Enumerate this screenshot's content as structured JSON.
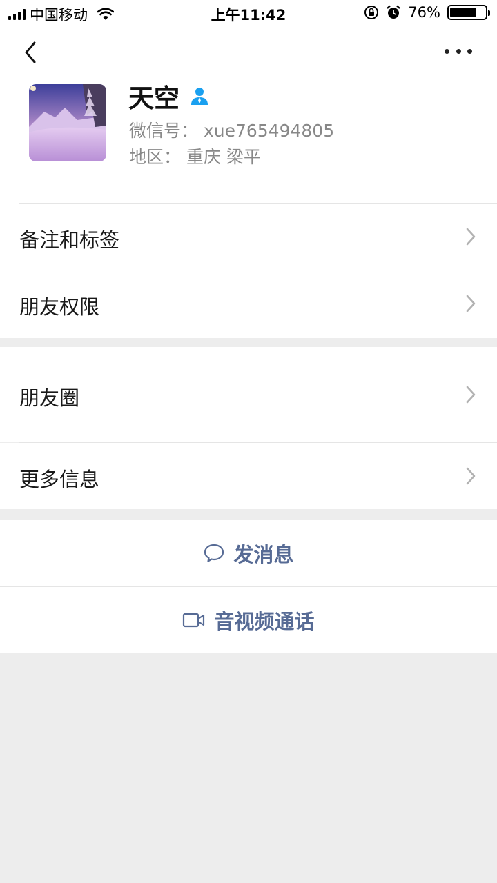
{
  "status_bar": {
    "carrier": "中国移动",
    "time": "上午11:42",
    "battery": "76%",
    "battery_level": 0.76,
    "icons": [
      "signal-icon",
      "wifi-icon",
      "rotation-lock-icon",
      "alarm-icon",
      "battery-icon"
    ]
  },
  "nav": {
    "back_icon": "chevron-left-icon",
    "more_icon": "more-dots-icon"
  },
  "profile": {
    "name": "天空",
    "wechat_id_line": "微信号： xue765494805",
    "region_line": "地区： 重庆 梁平",
    "badge_icon": "person-icon",
    "badge_color": "#1aa0f0"
  },
  "menu": {
    "remarks_tags": "备注和标签",
    "friend_permissions": "朋友权限",
    "moments": "朋友圈",
    "more_info": "更多信息"
  },
  "actions": {
    "send_message": "发消息",
    "av_call": "音视频通话",
    "link_color": "#576b95"
  }
}
